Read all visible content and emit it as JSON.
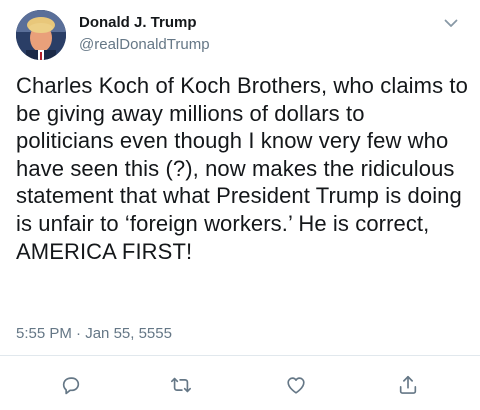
{
  "author": {
    "display_name": "Donald J. Trump",
    "handle": "@realDonaldTrump"
  },
  "tweet": {
    "text": "Charles Koch of Koch Brothers, who claims to be giving away millions of dollars to politicians even though I know very few who have seen this (?), now makes the ridiculous statement that what President Trump is doing is unfair to ‘foreign workers.’ He is correct, AMERICA FIRST!",
    "time": "5:55 PM",
    "separator": "·",
    "date": "Jan 55, 5555"
  },
  "icons": {
    "menu": "chevron-down-icon",
    "reply": "reply-icon",
    "retweet": "retweet-icon",
    "like": "heart-icon",
    "share": "share-icon"
  },
  "colors": {
    "text": "#14171a",
    "secondary": "#657786",
    "divider": "#e1e8ed"
  }
}
